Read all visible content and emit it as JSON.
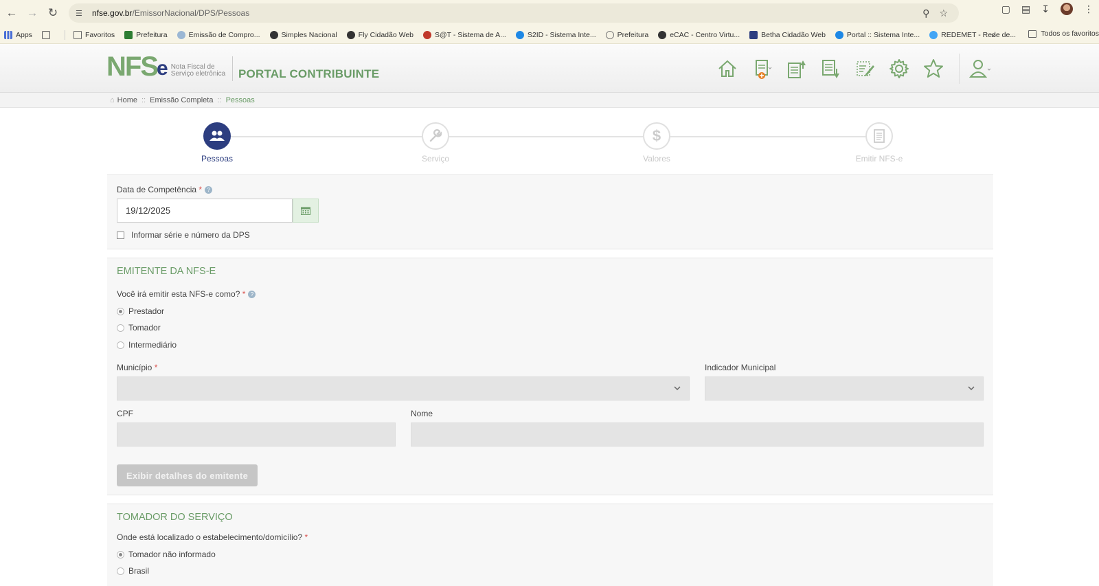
{
  "browser": {
    "url_host": "nfse.gov.br",
    "url_path": "/EmissorNacional/DPS/Pessoas",
    "bookmarks": [
      {
        "label": "Apps",
        "color": "#4a6fd6"
      },
      {
        "label": "Favoritos",
        "color": "#666"
      },
      {
        "label": "Prefeitura",
        "color": "#2e7d32"
      },
      {
        "label": "Emissão de Compro...",
        "color": "#9bb7d4"
      },
      {
        "label": "Simples Nacional",
        "color": "#333"
      },
      {
        "label": "Fly Cidadão Web",
        "color": "#333"
      },
      {
        "label": "S@T - Sistema de A...",
        "color": "#c0392b"
      },
      {
        "label": "S2ID - Sistema Inte...",
        "color": "#1e88e5"
      },
      {
        "label": "Prefeitura",
        "color": "#777"
      },
      {
        "label": "eCAC - Centro Virtu...",
        "color": "#333"
      },
      {
        "label": "Betha Cidadão Web",
        "color": "#2d3e80"
      },
      {
        "label": "Portal :: Sistema Inte...",
        "color": "#1e88e5"
      },
      {
        "label": "REDEMET - Rede de...",
        "color": "#42a5f5"
      }
    ],
    "all_bookmarks_label": "Todos os favoritos"
  },
  "header": {
    "logo_main": "NFS",
    "logo_e": "e",
    "logo_sub_1": "Nota Fiscal de",
    "logo_sub_2": "Serviço eletrônica",
    "portal_title": "PORTAL CONTRIBUINTE"
  },
  "breadcrumb": {
    "home": "Home",
    "level1": "Emissão Completa",
    "current": "Pessoas"
  },
  "stepper": {
    "steps": [
      {
        "label": "Pessoas",
        "active": true
      },
      {
        "label": "Serviço",
        "active": false
      },
      {
        "label": "Valores",
        "active": false
      },
      {
        "label": "Emitir NFS-e",
        "active": false
      }
    ]
  },
  "competencia": {
    "label": "Data de Competência",
    "value": "19/12/2025",
    "serie_checkbox_label": "Informar série e número da DPS"
  },
  "emitente": {
    "title": "EMITENTE DA NFS-E",
    "question": "Você irá emitir esta NFS-e como?",
    "options": [
      "Prestador",
      "Tomador",
      "Intermediário"
    ],
    "selected_option": "Prestador",
    "municipio_label": "Município",
    "indicador_label": "Indicador Municipal",
    "cpf_label": "CPF",
    "nome_label": "Nome",
    "details_button": "Exibir detalhes do emitente"
  },
  "tomador": {
    "title": "TOMADOR DO SERVIÇO",
    "question": "Onde está localizado o estabelecimento/domicílio?",
    "options": [
      "Tomador não informado",
      "Brasil"
    ],
    "selected_option": "Tomador não informado"
  },
  "colors": {
    "brand_green": "#6a9c67",
    "brand_navy": "#2d3e80",
    "accent_orange": "#e67e22"
  }
}
